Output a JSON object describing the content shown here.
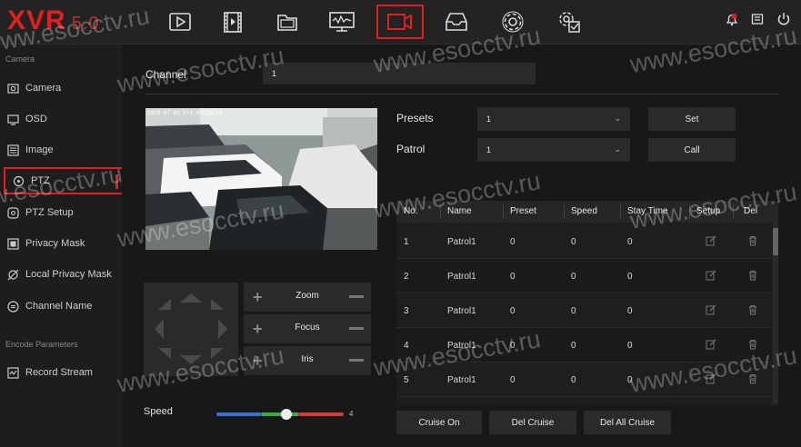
{
  "app": {
    "logo": "XVR",
    "version": "5.0"
  },
  "nav": {
    "items": [
      {
        "name": "playback-icon"
      },
      {
        "name": "video-file-icon"
      },
      {
        "name": "folder-icon"
      },
      {
        "name": "network-icon"
      },
      {
        "name": "camera-icon",
        "active": true
      },
      {
        "name": "storage-icon"
      },
      {
        "name": "settings-icon"
      },
      {
        "name": "system-icon"
      }
    ],
    "right_icons": [
      "alarm-bell-icon",
      "message-icon",
      "power-icon"
    ]
  },
  "sidebar": {
    "section_camera": "Camera",
    "items": [
      {
        "label": "Camera",
        "icon": "camera-icon"
      },
      {
        "label": "OSD",
        "icon": "monitor-icon"
      },
      {
        "label": "Image",
        "icon": "image-icon"
      },
      {
        "label": "PTZ",
        "icon": "ptz-icon",
        "active": true
      },
      {
        "label": "PTZ Setup",
        "icon": "ptz-setup-icon"
      },
      {
        "label": "Privacy Mask",
        "icon": "privacy-mask-icon"
      },
      {
        "label": "Local Privacy Mask",
        "icon": "local-privacy-icon"
      },
      {
        "label": "Channel Name",
        "icon": "channel-name-icon"
      }
    ],
    "section_encode": "Encode Parameters",
    "encode_items": [
      {
        "label": "Record Stream",
        "icon": "record-stream-icon"
      }
    ]
  },
  "main": {
    "channel_label": "Channel",
    "channel_value": "1",
    "camera_timestamp": "2020-07-03 Fri 05:13:18",
    "presets_label": "Presets",
    "presets_value": "1",
    "set_button": "Set",
    "patrol_label": "Patrol",
    "patrol_value": "1",
    "call_button": "Call",
    "ptz": {
      "zoom_label": "Zoom",
      "focus_label": "Focus",
      "iris_label": "Iris"
    },
    "speed_label": "Speed",
    "speed_value": "4",
    "speed_level": 0.55,
    "table": {
      "headers": [
        "No.",
        "Name",
        "Preset",
        "Speed",
        "Stay Time",
        "Setup",
        "Del"
      ],
      "rows": [
        {
          "no": "1",
          "name": "Patrol1",
          "preset": "0",
          "speed": "0",
          "stay": "0"
        },
        {
          "no": "2",
          "name": "Patrol1",
          "preset": "0",
          "speed": "0",
          "stay": "0"
        },
        {
          "no": "3",
          "name": "Patrol1",
          "preset": "0",
          "speed": "0",
          "stay": "0"
        },
        {
          "no": "4",
          "name": "Patrol1",
          "preset": "0",
          "speed": "0",
          "stay": "0"
        },
        {
          "no": "5",
          "name": "Patrol1",
          "preset": "0",
          "speed": "0",
          "stay": "0"
        }
      ]
    },
    "cruise_on": "Cruise On",
    "del_cruise": "Del Cruise",
    "del_all_cruise": "Del All Cruise"
  },
  "watermark": "www.esocctv.ru",
  "colors": {
    "accent": "#e01f1f",
    "background": "#181818",
    "panel": "#2a2a2a"
  }
}
